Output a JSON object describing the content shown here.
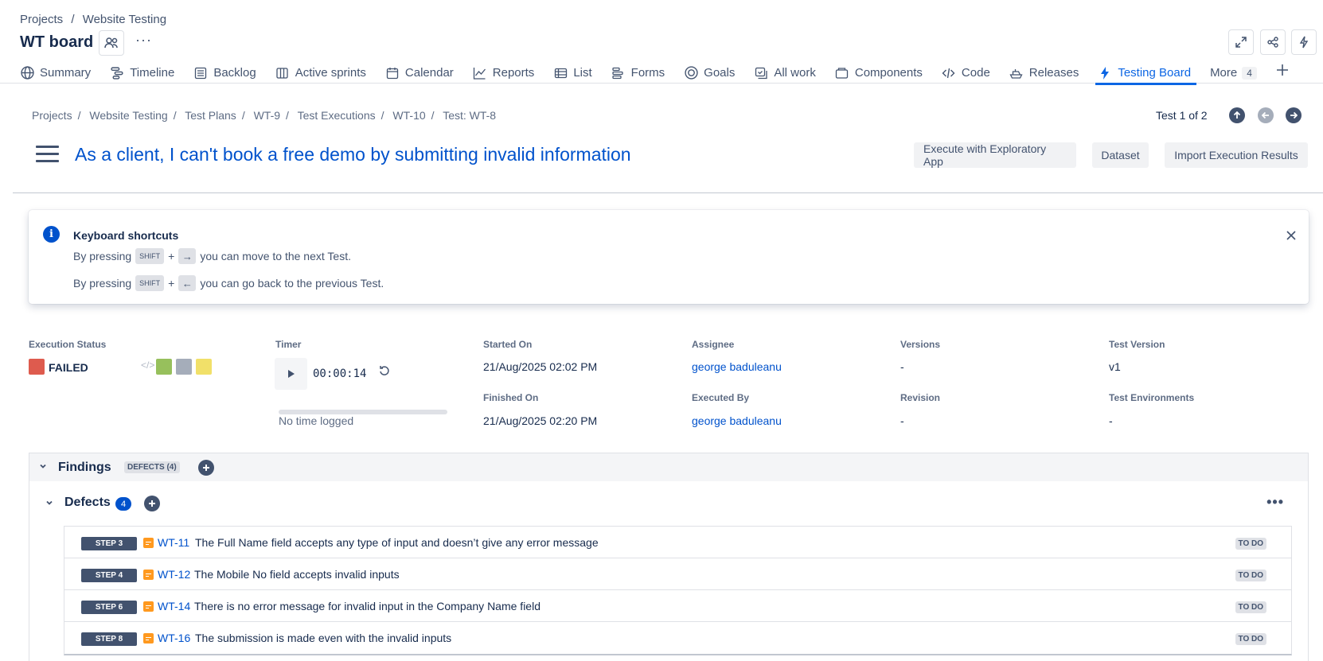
{
  "header": {
    "crumb": [
      "Projects",
      "/",
      "Website Testing"
    ],
    "board_title": "WT board",
    "more_dots": "···"
  },
  "nav": {
    "tabs": [
      {
        "label": "Summary",
        "icon": "globe-icon"
      },
      {
        "label": "Timeline",
        "icon": "timeline-icon"
      },
      {
        "label": "Backlog",
        "icon": "backlog-icon"
      },
      {
        "label": "Active sprints",
        "icon": "board-icon"
      },
      {
        "label": "Calendar",
        "icon": "calendar-icon"
      },
      {
        "label": "Reports",
        "icon": "chart-icon"
      },
      {
        "label": "List",
        "icon": "list-icon"
      },
      {
        "label": "Forms",
        "icon": "forms-icon"
      },
      {
        "label": "Goals",
        "icon": "goal-icon"
      },
      {
        "label": "All work",
        "icon": "all-work-icon"
      },
      {
        "label": "Components",
        "icon": "component-icon"
      },
      {
        "label": "Code",
        "icon": "code-icon"
      },
      {
        "label": "Releases",
        "icon": "ship-icon"
      },
      {
        "label": "Testing Board",
        "icon": "bolt-icon",
        "active": true
      }
    ],
    "more_label": "More",
    "more_count": "4"
  },
  "breadcrumb2": [
    "Projects",
    "Website Testing",
    "Test Plans",
    "WT-9",
    "Test Executions",
    "WT-10",
    "Test: WT-8"
  ],
  "test_nav": {
    "position": "Test 1 of 2"
  },
  "title": "As a client, I can't book a free demo by submitting invalid information",
  "actions": {
    "exploratory": "Execute with Exploratory App",
    "dataset": "Dataset",
    "import": "Import Execution Results"
  },
  "banner": {
    "title": "Keyboard shortcuts",
    "line1_pre": "By pressing",
    "line1_key": "SHIFT",
    "plus": "+",
    "line1_arrow": "→",
    "line1_post": "you can move to the next Test.",
    "line2_pre": "By pressing",
    "line2_key": "SHIFT",
    "line2_arrow": "←",
    "line2_post": "you can go back to the previous Test."
  },
  "execution": {
    "status_label": "Execution Status",
    "status_value": "FAILED",
    "status_color": "#de5b4e",
    "timer_label": "Timer",
    "timer_value": "00:00:14",
    "no_time": "No time logged",
    "started_label": "Started On",
    "started_value": "21/Aug/2025 02:02 PM",
    "finished_label": "Finished On",
    "finished_value": "21/Aug/2025 02:20 PM",
    "assignee_label": "Assignee",
    "assignee_value": "george baduleanu",
    "executed_label": "Executed By",
    "executed_value": "george baduleanu",
    "versions_label": "Versions",
    "versions_value": "-",
    "revision_label": "Revision",
    "revision_value": "-",
    "test_version_label": "Test Version",
    "test_version_value": "v1",
    "test_env_label": "Test Environments",
    "test_env_value": "-"
  },
  "findings": {
    "title": "Findings",
    "tag": "DEFECTS (4)",
    "defects_title": "Defects",
    "defects_count": "4",
    "rows": [
      {
        "step": "STEP 3",
        "key": "WT-11",
        "summary": "The Full Name field accepts any type of input and doesn’t give any error message",
        "status": "TO DO"
      },
      {
        "step": "STEP 4",
        "key": "WT-12",
        "summary": "The Mobile No field accepts invalid inputs",
        "status": "TO DO"
      },
      {
        "step": "STEP 6",
        "key": "WT-14",
        "summary": "There is no error message for invalid input in the Company Name field",
        "status": "TO DO"
      },
      {
        "step": "STEP 8",
        "key": "WT-16",
        "summary": "The submission is made even with the invalid inputs",
        "status": "TO DO"
      }
    ]
  },
  "colors": {
    "accent": "#0c66e4",
    "link": "#0052cc",
    "failed": "#de5b4e",
    "passed": "#97c05c",
    "todo": "#a5adba",
    "executing": "#f1e069"
  }
}
